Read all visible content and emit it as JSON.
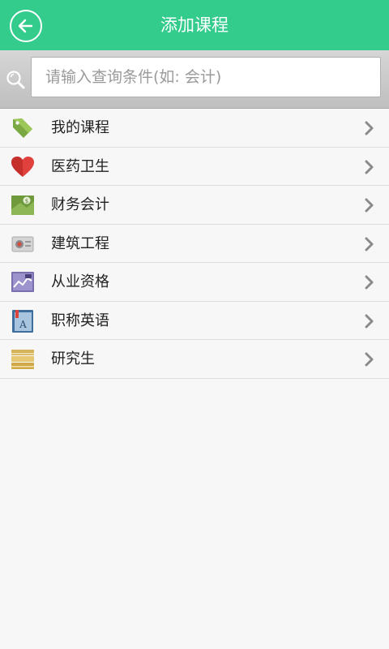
{
  "header": {
    "title": "添加课程",
    "back_icon": "arrow-left-circle-icon"
  },
  "search": {
    "placeholder": "请输入查询条件(如: 会计)",
    "value": ""
  },
  "categories": [
    {
      "label": "我的课程",
      "icon": "tag-icon"
    },
    {
      "label": "医药卫生",
      "icon": "heart-icon"
    },
    {
      "label": "财务会计",
      "icon": "money-icon"
    },
    {
      "label": "建筑工程",
      "icon": "building-icon"
    },
    {
      "label": "从业资格",
      "icon": "chart-board-icon"
    },
    {
      "label": "职称英语",
      "icon": "book-icon"
    },
    {
      "label": "研究生",
      "icon": "books-stack-icon"
    }
  ],
  "colors": {
    "accent": "#33cc8c",
    "background": "#f8f7f8"
  }
}
